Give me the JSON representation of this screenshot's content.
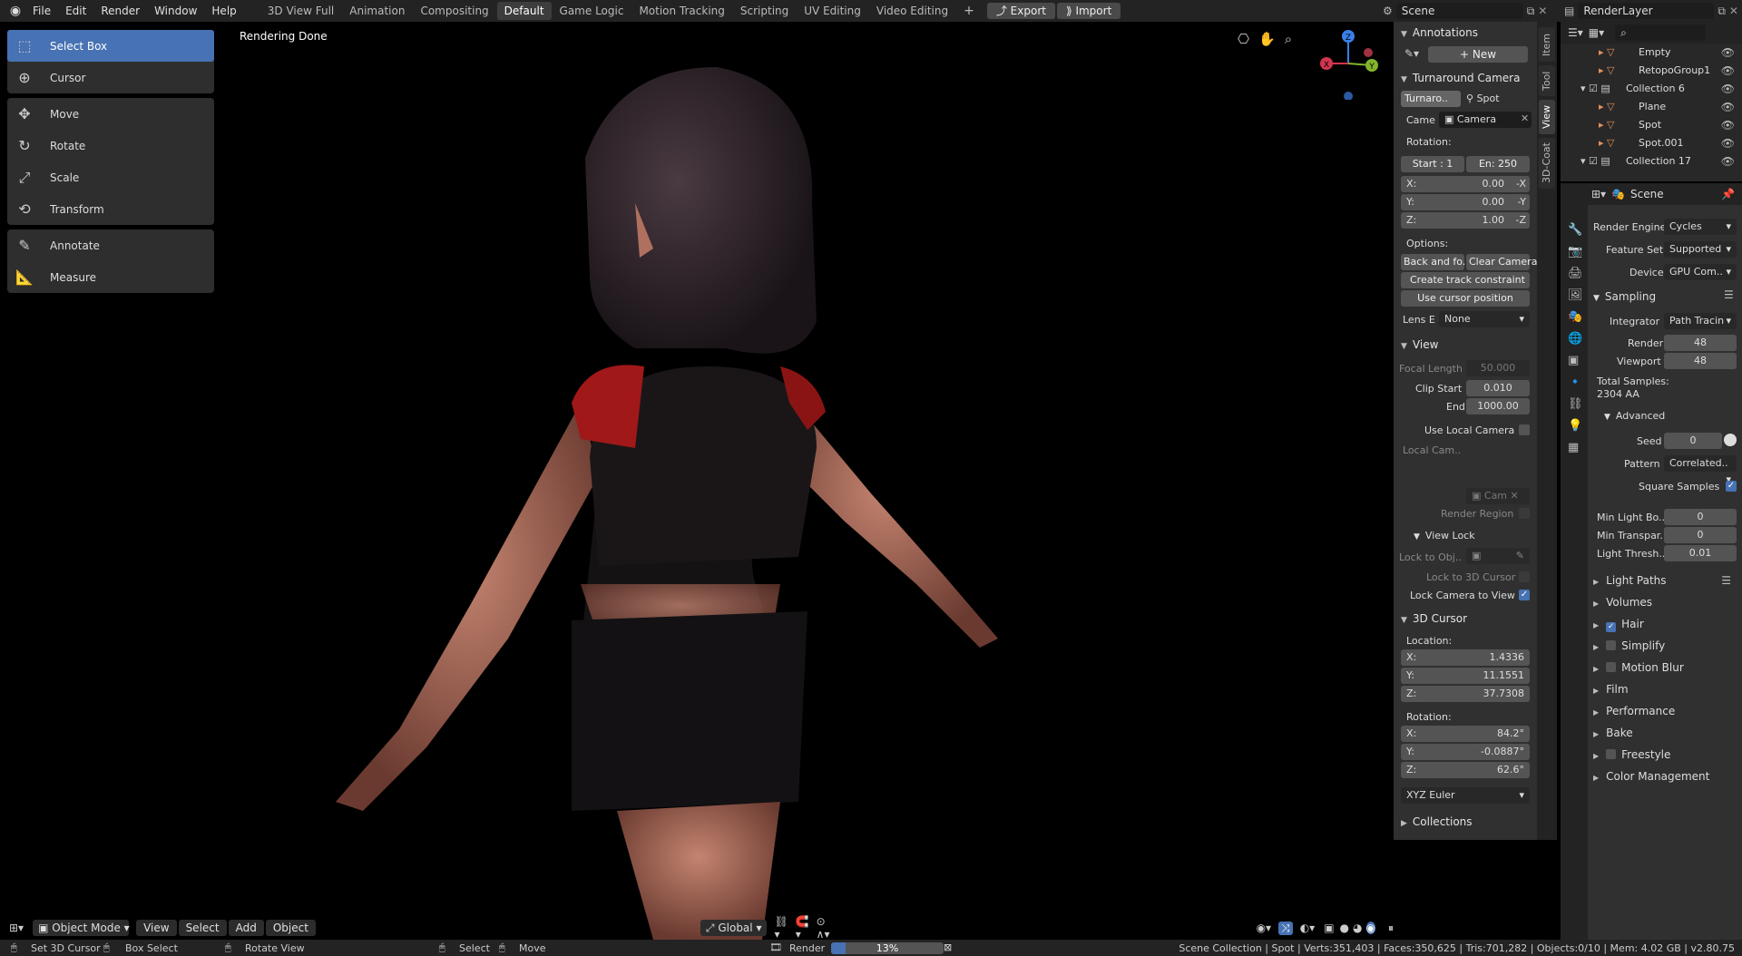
{
  "topbar": {
    "menus": [
      "File",
      "Edit",
      "Render",
      "Window",
      "Help"
    ],
    "workspaces": [
      "3D View Full",
      "Animation",
      "Compositing",
      "Default",
      "Game Logic",
      "Motion Tracking",
      "Scripting",
      "UV Editing",
      "Video Editing"
    ],
    "active_workspace": "Default",
    "export": "Export",
    "import": "Import",
    "scene": "Scene",
    "render_layer": "RenderLayer"
  },
  "viewport": {
    "status": "Rendering Done",
    "tools": [
      [
        "Select Box",
        "Cursor"
      ],
      [
        "Move",
        "Rotate",
        "Scale",
        "Transform"
      ],
      [
        "Annotate",
        "Measure"
      ]
    ],
    "mode": "Object Mode",
    "header_menus": [
      "View",
      "Select",
      "Add",
      "Object"
    ],
    "orientation": "Global",
    "gizmo": {
      "x": "X",
      "y": "Y",
      "z": "Z"
    }
  },
  "npanel": {
    "annotations": {
      "title": "Annotations",
      "new": "New"
    },
    "turnaround": {
      "title": "Turnaround Camera",
      "tab1": "Turnaro..",
      "tab2": "Spot",
      "came_label": "Came",
      "camera": "Camera",
      "rotation": "Rotation:",
      "start": "Start : 1",
      "end": "En:  250",
      "x": "X:",
      "xv": "0.00",
      "xa": "-X",
      "y": "Y:",
      "yv": "0.00",
      "ya": "-Y",
      "z": "Z:",
      "zv": "1.00",
      "za": "-Z",
      "options": "Options:",
      "back": "Back and fo..",
      "clear": "Clear Camera",
      "track": "Create track constraint",
      "cursorpos": "Use cursor position",
      "lens_label": "Lens E",
      "lens": "None"
    },
    "view": {
      "title": "View",
      "focal_label": "Focal Length",
      "focal": "50.000",
      "clipstart_label": "Clip Start",
      "clipstart": "0.010",
      "end_label": "End",
      "end": "1000.00",
      "use_local": "Use Local Camera",
      "local_cam_label": "Local Cam..",
      "local_cam": "Cam",
      "render_region": "Render Region",
      "viewlock": "View Lock",
      "lock_obj": "Lock to Obj..",
      "lock_cursor": "Lock to 3D Cursor",
      "lock_cam": "Lock Camera to View"
    },
    "cursor3d": {
      "title": "3D Cursor",
      "location": "Location:",
      "lx": "1.4336",
      "ly": "11.1551",
      "lz": "37.7308",
      "rotation": "Rotation:",
      "rx": "84.2°",
      "ry": "-0.0887°",
      "rz": "62.6°",
      "x": "X:",
      "y": "Y:",
      "z": "Z:",
      "mode": "XYZ Euler"
    },
    "collections": "Collections"
  },
  "vtabs": [
    "Item",
    "Tool",
    "View",
    "3D-Coat"
  ],
  "outliner": {
    "items": [
      {
        "name": "Empty",
        "indent": 2
      },
      {
        "name": "RetopoGroup1",
        "indent": 2
      },
      {
        "name": "Collection 6",
        "indent": 1
      },
      {
        "name": "Plane",
        "indent": 2
      },
      {
        "name": "Spot",
        "indent": 2
      },
      {
        "name": "Spot.001",
        "indent": 2
      },
      {
        "name": "Collection 17",
        "indent": 1
      }
    ]
  },
  "properties": {
    "header": "Scene",
    "render_engine_label": "Render Engine",
    "render_engine": "Cycles",
    "feature_set_label": "Feature Set",
    "feature_set": "Supported",
    "device_label": "Device",
    "device": "GPU Com..",
    "sampling": "Sampling",
    "integrator_label": "Integrator",
    "integrator": "Path Tracin",
    "render_label": "Render",
    "render": "48",
    "viewport_label": "Viewport",
    "viewport": "48",
    "total_samples": "Total Samples:",
    "aa": "2304 AA",
    "advanced": "Advanced",
    "seed_label": "Seed",
    "seed": "0",
    "pattern_label": "Pattern",
    "pattern": "Correlated..",
    "square_samples": "Square Samples",
    "min_light_label": "Min Light Bo..",
    "min_light": "0",
    "min_transp_label": "Min Transpar..",
    "min_transp": "0",
    "light_thresh_label": "Light Thresh..",
    "light_thresh": "0.01",
    "sections": [
      "Light Paths",
      "Volumes",
      "Hair",
      "Simplify",
      "Motion Blur",
      "Film",
      "Performance",
      "Bake",
      "Freestyle",
      "Color Management"
    ]
  },
  "status": {
    "left1": "Set 3D Cursor",
    "left2": "Box Select",
    "left3": "Rotate View",
    "mid1": "Select",
    "mid2": "Move",
    "render_label": "Render",
    "progress": "13%",
    "progress_value": 0.13,
    "right": "Scene Collection | Spot | Verts:351,403 | Faces:350,625 | Tris:701,282 | Objects:0/10 | Mem: 4.02 GB | v2.80.75"
  },
  "colors": {
    "accent": "#4772b3",
    "bg": "#303030",
    "header": "#232323"
  }
}
